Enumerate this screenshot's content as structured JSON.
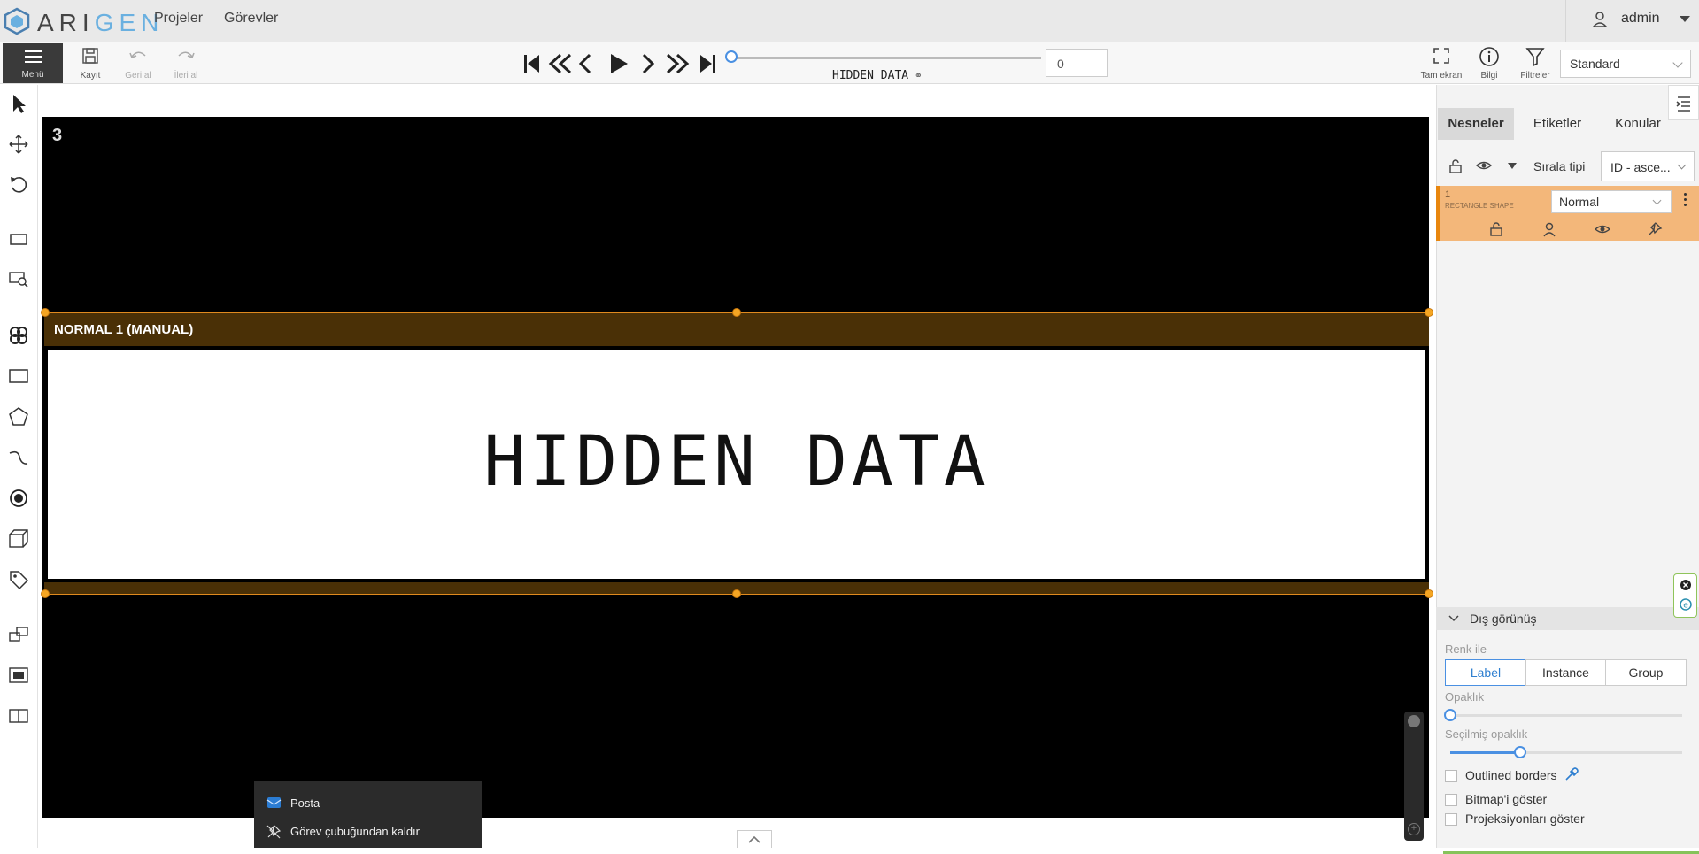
{
  "app": {
    "brand_prefix": "ARI",
    "brand_suffix": "GEN"
  },
  "nav": {
    "projects": "Projeler",
    "tasks": "Görevler"
  },
  "user": {
    "name": "admin"
  },
  "toolbar": {
    "menu_label": "Menü",
    "save_label": "Kayıt",
    "undo_label": "Geri al",
    "redo_label": "İleri al",
    "frame_value": "0",
    "job_name": "HIDDEN DATA",
    "fullscreen_label": "Tam ekran",
    "info_label": "Bilgi",
    "filters_label": "Filtreler",
    "workspace_value": "Standard"
  },
  "canvas": {
    "frame_number": "3",
    "object_label": "NORMAL 1 (MANUAL)",
    "image_text": "HIDDEN DATA"
  },
  "sidebar": {
    "tabs": [
      "Nesneler",
      "Etiketler",
      "Konular"
    ],
    "sort_label": "Sırala tipi",
    "sort_value": "ID - asce...",
    "object": {
      "id": "1",
      "type": "RECTANGLE SHAPE",
      "label_value": "Normal"
    },
    "appearance": {
      "title": "Dış görünüş",
      "color_by_label": "Renk ile",
      "color_by_options": [
        "Label",
        "Instance",
        "Group"
      ],
      "color_by_selected": "Label",
      "opacity_label": "Opaklık",
      "opacity_value": 0,
      "selected_opacity_label": "Seçilmiş opaklık",
      "selected_opacity_value": 0.3,
      "outlined_borders_label": "Outlined borders",
      "show_bitmap_label": "Bitmap'i göster",
      "show_projections_label": "Projeksiyonları göster"
    }
  },
  "taskbar_menu": {
    "items": [
      "Posta",
      "Görev çubuğundan kaldır"
    ]
  },
  "colors": {
    "accent": "#4a90e2",
    "object_orange": "#f5a623",
    "label_bar": "#4a3006"
  }
}
